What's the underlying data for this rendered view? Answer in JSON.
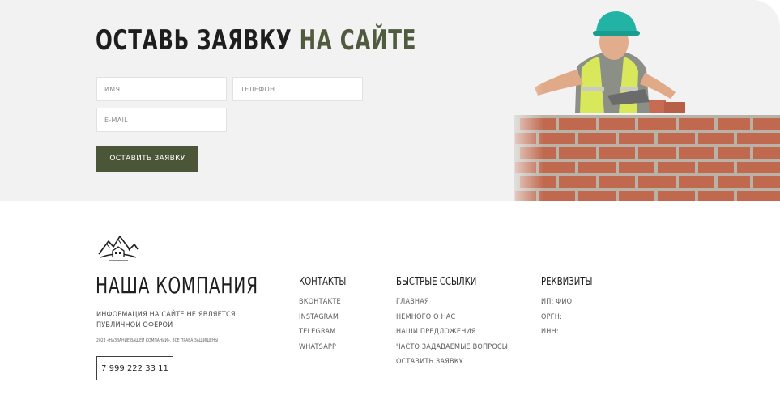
{
  "hero": {
    "title_main": "ОСТАВЬ ЗАЯВКУ ",
    "title_accent": "НА САЙТЕ",
    "accent_color": "#4f5a3e",
    "name_placeholder": "ИМЯ",
    "phone_placeholder": "ТЕЛЕФОН",
    "email_placeholder": "E-MAIL",
    "submit_label": "ОСТАВИТЬ ЗАЯВКУ",
    "button_color": "#4b5638"
  },
  "footer": {
    "logo_icon": "mountain-house-logo-icon",
    "company_name": "НАША КОМПАНИЯ",
    "disclaimer": "ИНФОРМАЦИЯ НА САЙТЕ НЕ ЯВЛЯЕТСЯ ПУБЛИЧНОЙ ОФЕРОЙ",
    "copyright": "2023 «НАЗВАНИЕ ВАШЕЙ КОМПАНИИ». ВСЕ ПРАВА ЗАЩИЩЕНЫ",
    "phone": "7 999 222 33 11",
    "contacts": {
      "heading": "КОНТАКТЫ",
      "items": [
        "ВКОНТАКТЕ",
        "INSTAGRAM",
        "TELEGRAM",
        "WHATSAPP"
      ]
    },
    "quick_links": {
      "heading": "БЫСТРЫЕ ССЫЛКИ",
      "items": [
        "ГЛАВНАЯ",
        "НЕМНОГО О НАС",
        "НАШИ ПРЕДЛОЖЕНИЯ",
        "ЧАСТО ЗАДАВАЕМЫЕ ВОПРОСЫ",
        "ОСТАВИТЬ ЗАЯВКУ"
      ]
    },
    "requisites": {
      "heading": "РЕКВИЗИТЫ",
      "items": [
        "ИП: ФИО",
        "ОРГН:",
        "ИНН:"
      ]
    }
  }
}
